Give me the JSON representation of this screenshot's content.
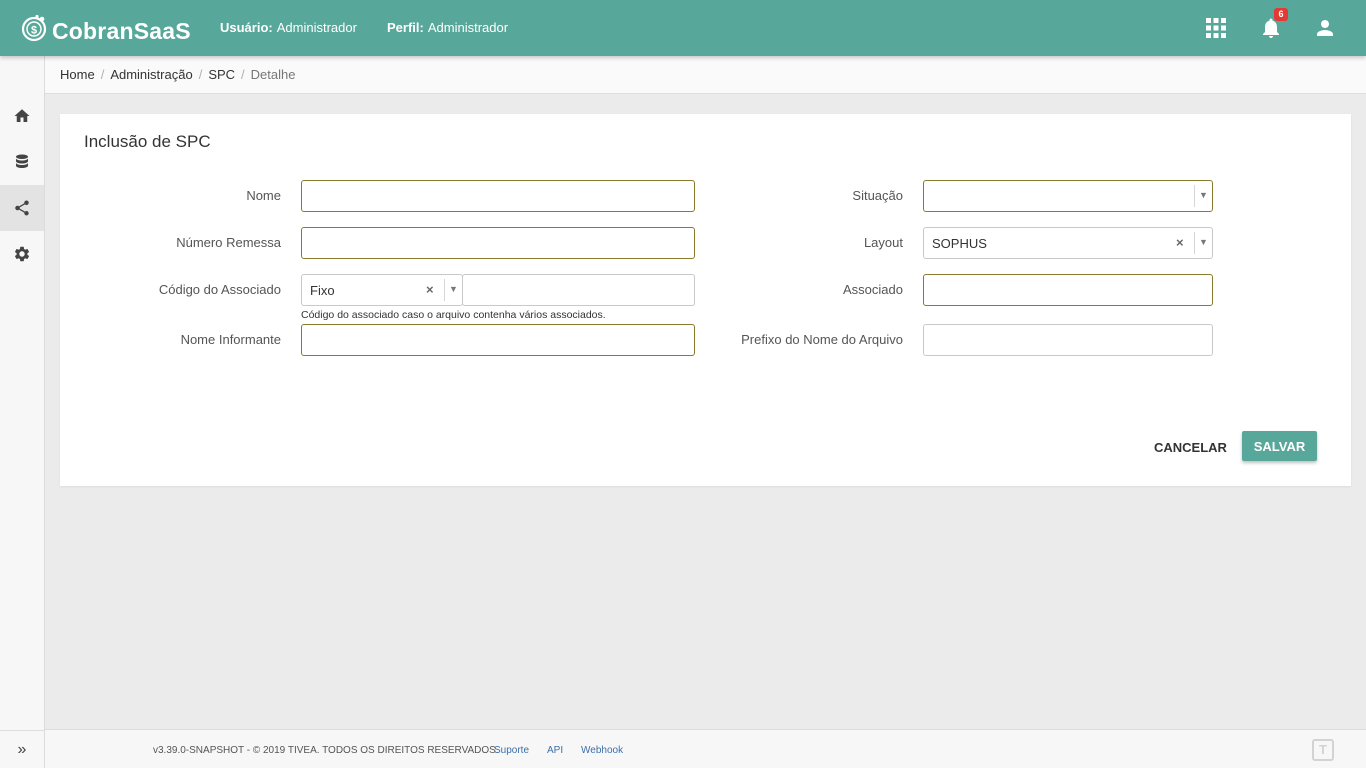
{
  "app": {
    "name": "CobranSaaS"
  },
  "header": {
    "user_label": "Usuário:",
    "user_value": "Administrador",
    "profile_label": "Perfil:",
    "profile_value": "Administrador",
    "notifications_count": "6",
    "icons": [
      "apps-grid-icon",
      "bell-icon",
      "user-icon"
    ]
  },
  "sidebar": {
    "items": [
      {
        "icon": "home-icon"
      },
      {
        "icon": "database-icon"
      },
      {
        "icon": "share-icon",
        "active": true
      },
      {
        "icon": "gear-icon"
      }
    ],
    "expand_label": "»"
  },
  "breadcrumb": [
    "Home",
    "Administração",
    "SPC",
    "Detalhe"
  ],
  "form": {
    "title": "Inclusão de SPC",
    "nome": {
      "label": "Nome",
      "value": ""
    },
    "numero_remessa": {
      "label": "Número Remessa",
      "value": ""
    },
    "codigo_associado": {
      "label": "Código do Associado",
      "select_value": "Fixo",
      "value": "",
      "help": "Código do associado caso o arquivo contenha vários associados."
    },
    "nome_informante": {
      "label": "Nome Informante",
      "value": ""
    },
    "situacao": {
      "label": "Situação",
      "value": ""
    },
    "layout": {
      "label": "Layout",
      "value": "SOPHUS"
    },
    "associado": {
      "label": "Associado",
      "value": ""
    },
    "prefixo": {
      "label": "Prefixo do Nome do Arquivo",
      "value": ""
    },
    "clear_glyph": "×",
    "arrow_glyph": "▼",
    "cancel_label": "CANCELAR",
    "save_label": "SALVAR"
  },
  "footer": {
    "copyright": "v3.39.0-SNAPSHOT - © 2019 TIVEA. TODOS OS DIREITOS RESERVADOS.",
    "links": [
      "Suporte",
      "API",
      "Webhook"
    ],
    "watermark": "T"
  },
  "colors": {
    "primary": "#57a89a",
    "badge": "#e53935",
    "input_border": "#8a7a2c",
    "link": "#3d6fa8"
  }
}
